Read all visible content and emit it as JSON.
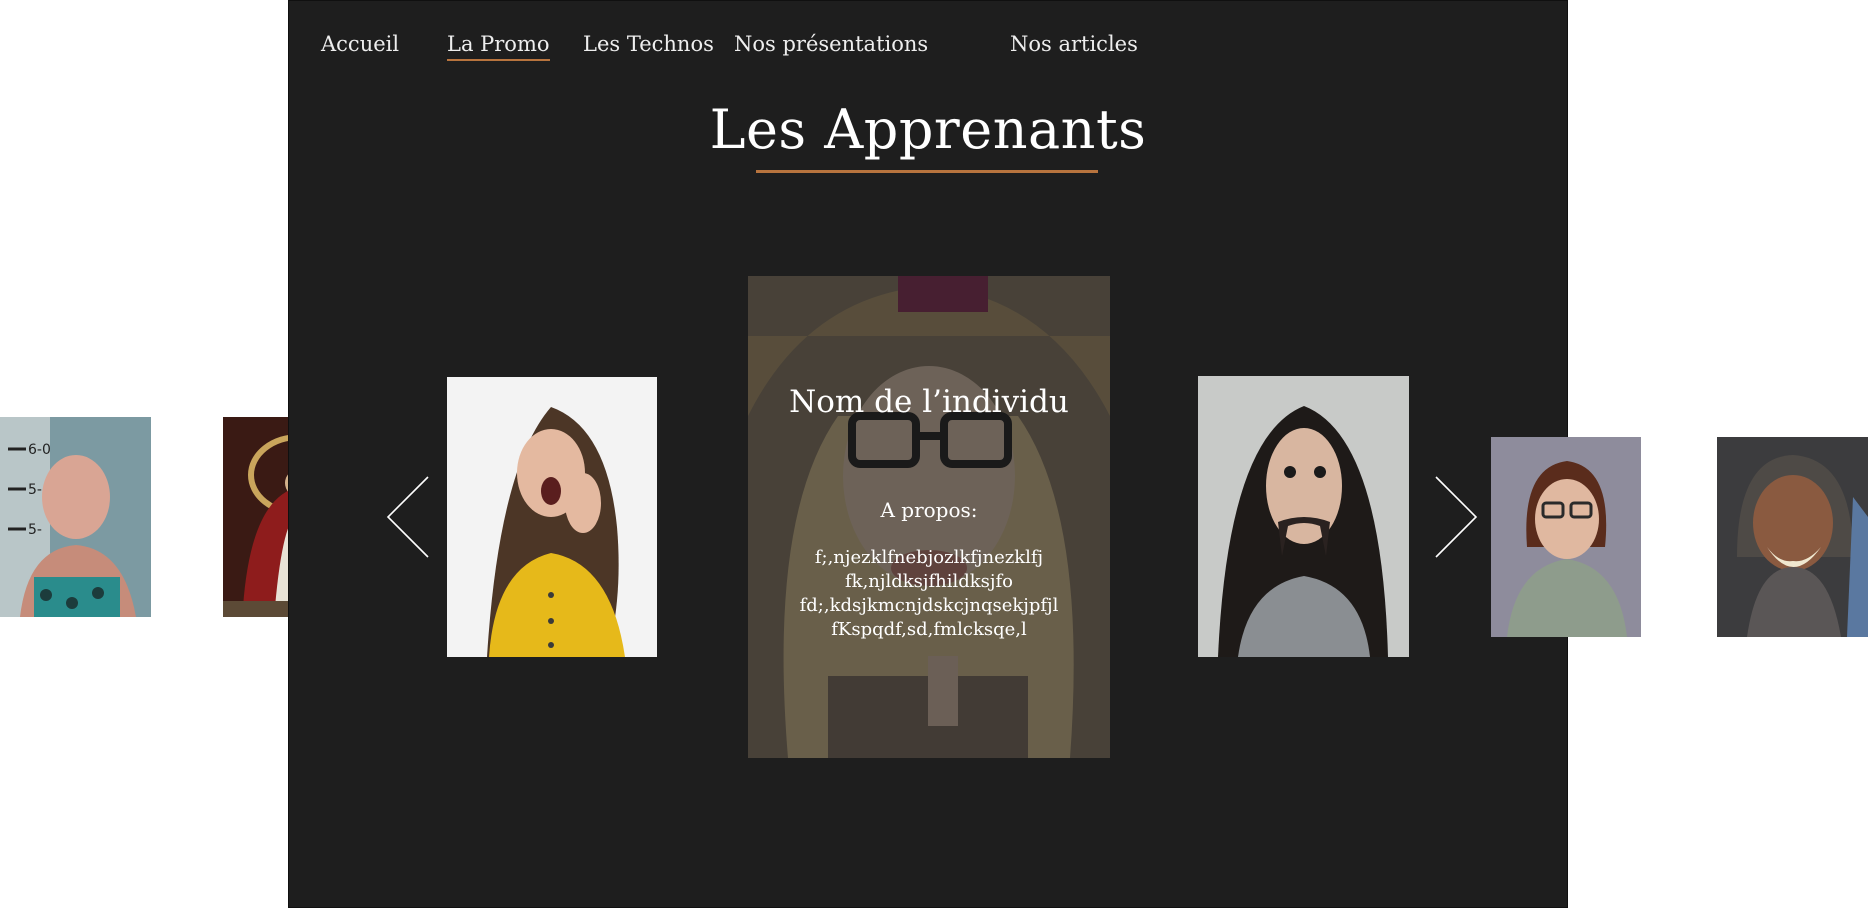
{
  "nav": {
    "items": [
      {
        "label": "Accueil",
        "active": false
      },
      {
        "label": "La Promo",
        "active": true
      },
      {
        "label": "Les Technos",
        "active": false
      },
      {
        "label": "Nos présentations",
        "active": false
      },
      {
        "label": "Nos articles",
        "active": false
      }
    ]
  },
  "page": {
    "title": "Les Apprenants"
  },
  "carousel": {
    "prev_icon": "chevron-left-icon",
    "next_icon": "chevron-right-icon",
    "featured": {
      "name": "Nom de l’individu",
      "about_label": "A propos:",
      "bio_lines": [
        "f;,njezklfnebjozlkfjnezklfj",
        "fk,njldksjfhildksjfo",
        "fd;,kdsjkmcnjdskcjnqsekjpfjl",
        "fKspqdf,sd,fmlcksqe,l"
      ]
    }
  },
  "colors": {
    "panel": "#1e1e1e",
    "accent": "#b8743e",
    "text": "#ffffff"
  }
}
